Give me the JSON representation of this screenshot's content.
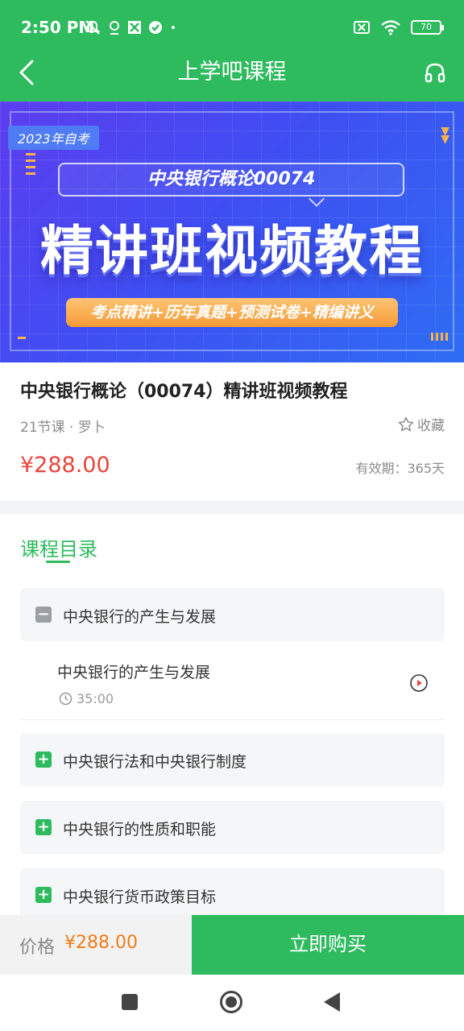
{
  "status_bar": {
    "time": "2:50 PM",
    "battery": "70"
  },
  "nav": {
    "title": "上学吧课程"
  },
  "banner": {
    "tag": "2023年自考",
    "subtitle": "中央银行概论00074",
    "main_title": "精讲班视频教程",
    "features": "考点精讲+历年真题+预测试卷+精编讲义"
  },
  "course": {
    "title": "中央银行概论（00074）精讲班视频教程",
    "meta": "21节课 · 罗卜",
    "favorite_label": "收藏",
    "price": "¥288.00",
    "validity": "有效期：365天"
  },
  "catalog": {
    "title": "课程目录",
    "chapters": [
      {
        "label": "中央银行的产生与发展",
        "expanded": true
      },
      {
        "label": "中央银行法和中央银行制度",
        "expanded": false
      },
      {
        "label": "中央银行的性质和职能",
        "expanded": false
      },
      {
        "label": "中央银行货币政策目标",
        "expanded": false
      }
    ],
    "lesson": {
      "title": "中央银行的产生与发展",
      "duration": "35:00"
    }
  },
  "buy_bar": {
    "price_label": "价格",
    "price": "¥288.00",
    "buy_label": "立即购买"
  },
  "colors": {
    "brand_green": "#2dbb5e",
    "price_red": "#e8453c",
    "price_orange": "#f07c1a",
    "collapsed_gray": "#9aa0a6"
  }
}
